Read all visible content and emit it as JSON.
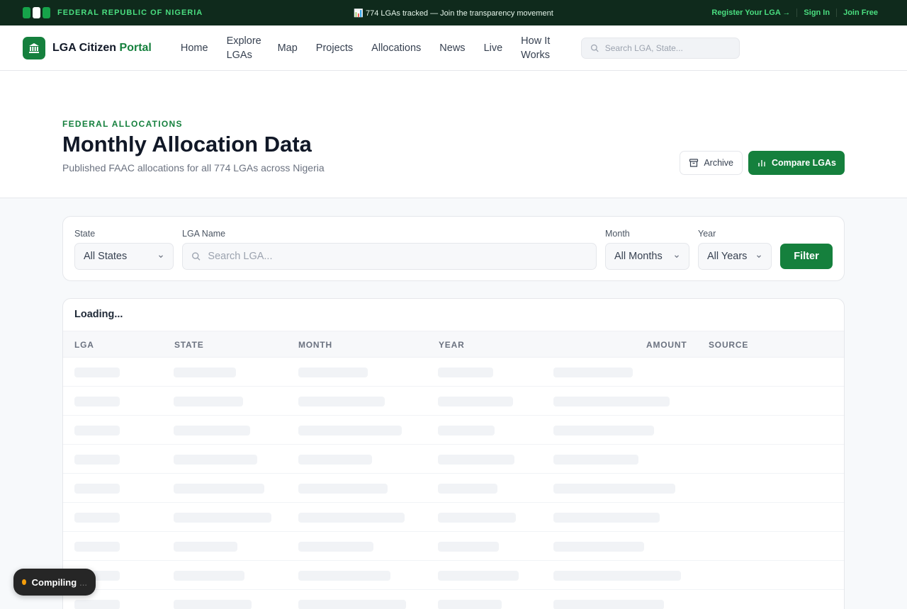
{
  "topbar": {
    "country": "FEDERAL REPUBLIC OF NIGERIA",
    "ticker_icon": "bar-chart-emoji",
    "ticker": "📊 774 LGAs tracked — Join the transparency movement",
    "register": "Register Your LGA →",
    "sign_in": "Sign In",
    "join": "Join Free",
    "colors": {
      "bg": "#0f2a1c",
      "accent": "#4ade80"
    }
  },
  "nav": {
    "brand_prefix": "LGA Citizen",
    "brand_accent": "Portal",
    "items": [
      "Home",
      "Explore LGAs",
      "Map",
      "Projects",
      "Allocations",
      "News",
      "Live",
      "How It Works"
    ],
    "search_placeholder": "Search LGA, State..."
  },
  "header": {
    "eyebrow": "FEDERAL ALLOCATIONS",
    "title": "Monthly Allocation Data",
    "subtitle": "Published FAAC allocations for all 774 LGAs across Nigeria",
    "archive_label": "Archive",
    "compare_label": "Compare LGAs"
  },
  "filters": {
    "state_label": "State",
    "state_value": "All States",
    "lga_label": "LGA Name",
    "lga_placeholder": "Search LGA...",
    "month_label": "Month",
    "month_value": "All Months",
    "year_label": "Year",
    "year_value": "All Years",
    "filter_button": "Filter"
  },
  "table": {
    "status": "Loading...",
    "columns": [
      "LGA",
      "STATE",
      "MONTH",
      "YEAR",
      "AMOUNT",
      "SOURCE"
    ]
  },
  "toast": {
    "label": "Compiling",
    "dots": "..."
  },
  "colors": {
    "brand_green": "#15803d",
    "skeleton": "#f1f3f6",
    "toast_dot": "#f59e0b"
  }
}
